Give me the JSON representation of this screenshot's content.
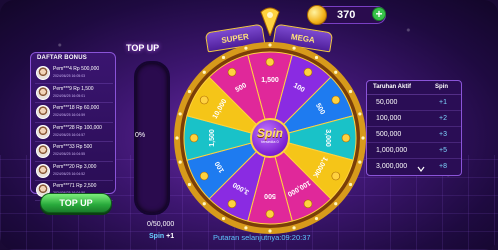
{
  "coins": {
    "amount": "370",
    "icon": "coin-icon",
    "add_label": "+"
  },
  "bonus_panel": {
    "title": "DAFTAR BONUS",
    "rows": [
      {
        "name": "Pem***4 Rp 500,000",
        "date": "2024/06/25 16:05:03"
      },
      {
        "name": "Pem***9 Rp 1,500",
        "date": "2024/06/25 16:05:01"
      },
      {
        "name": "Pem***18 Rp 60,000",
        "date": "2024/06/25 16:04:59"
      },
      {
        "name": "Pem***28 Rp 100,000",
        "date": "2024/06/25 16:04:57"
      },
      {
        "name": "Pem***33 Rp 500",
        "date": "2024/06/25 16:04:55"
      },
      {
        "name": "Pem***20 Rp 3,000",
        "date": "2024/06/25 16:04:52"
      },
      {
        "name": "Pem***71 Rp 2,500",
        "date": "2024/06/25 16:04:50"
      }
    ],
    "topup_label": "TOP UP"
  },
  "progress": {
    "title": "TOP UP",
    "percent_label": "0%",
    "fill_fraction": 0,
    "count_label": "0/50,000",
    "spin_label": "Spin",
    "spin_plus": "+1"
  },
  "wheel": {
    "modes": [
      "SUPER",
      "MEGA"
    ],
    "center_label": "Spin",
    "center_sub": "tersedia 0",
    "segments": [
      "1,500",
      "100",
      "500",
      "3,000",
      "1,000K",
      "100,000",
      "500",
      "3,000",
      "100",
      "1,500",
      "10,000",
      "500"
    ],
    "colors": {
      "pink": "#e0289a",
      "purple": "#8a2be2",
      "blue": "#1e7bf0",
      "teal": "#19c2c8",
      "yellow": "#f5c518",
      "gold": "#ffd23f"
    }
  },
  "countdown": "Putaran selanjutnya:09:20:37",
  "bet_table": {
    "headers": [
      "Taruhan Aktif",
      "Spin"
    ],
    "rows": [
      {
        "amount": "50,000",
        "bonus": "+1"
      },
      {
        "amount": "100,000",
        "bonus": "+2"
      },
      {
        "amount": "500,000",
        "bonus": "+3"
      },
      {
        "amount": "1,000,000",
        "bonus": "+5"
      },
      {
        "amount": "3,000,000",
        "bonus": "+8"
      }
    ]
  }
}
